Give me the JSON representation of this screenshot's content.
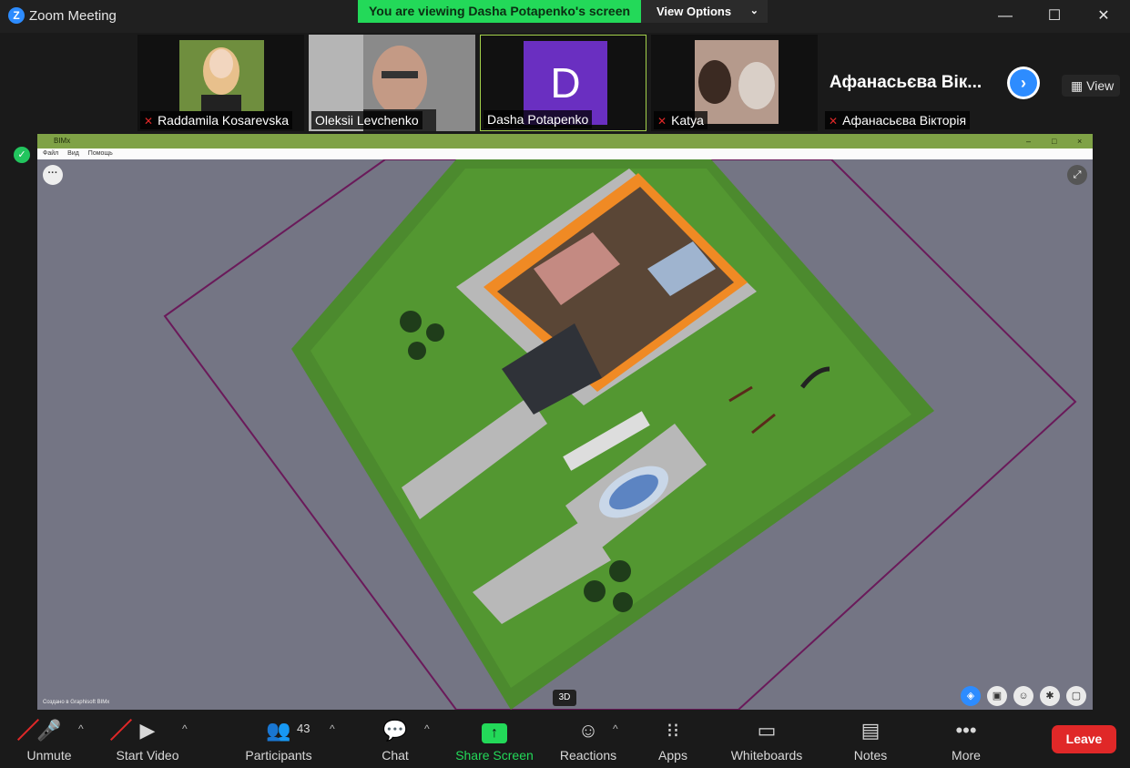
{
  "window": {
    "title": "Zoom Meeting",
    "logo": "Z",
    "controls": {
      "minimize": "—",
      "maximize": "☐",
      "close": "✕"
    }
  },
  "banner": {
    "text": "You are viewing Dasha Potapenko's screen",
    "view_options": "View Options",
    "chevron": "⌄"
  },
  "participants_strip": {
    "tiles": [
      {
        "name": "Raddamila Kosarevska",
        "muted": true
      },
      {
        "name": "Oleksii Levchenko",
        "muted": false
      },
      {
        "name": "Dasha Potapenko",
        "muted": false,
        "avatar_letter": "D",
        "avatar_color": "#6a2fc1",
        "active": true
      },
      {
        "name": "Katya",
        "muted": true
      },
      {
        "name": "Афанасьєва Вікторія",
        "display_name": "Афанасьєва Вік...",
        "muted": true
      }
    ],
    "next_icon": "›",
    "view_label": "View",
    "view_icon": "▦"
  },
  "security_icon": "✓",
  "shared_app": {
    "title": "BIMx",
    "menu": [
      "Файл",
      "Вид",
      "Помощь"
    ],
    "winbtns": [
      "–",
      "□",
      "×"
    ],
    "more_icon": "···",
    "expand_icon": "⤢",
    "credit": "Создано в Graphisoft BIMx",
    "mode": "3D",
    "tool_icons": [
      "◈",
      "▣",
      "☺",
      "✱",
      "▢"
    ]
  },
  "toolbar": {
    "unmute": "Unmute",
    "start_video": "Start Video",
    "participants": "Participants",
    "participants_count": "43",
    "chat": "Chat",
    "share_screen": "Share Screen",
    "reactions": "Reactions",
    "apps": "Apps",
    "whiteboards": "Whiteboards",
    "notes": "Notes",
    "more": "More",
    "leave": "Leave",
    "caret": "^",
    "icons": {
      "mic": "🎤",
      "video": "▶",
      "people": "👥",
      "chat": "💬",
      "share": "↑",
      "reactions": "☺",
      "apps": "⁝⁝",
      "whiteboard": "▭",
      "notes": "▤",
      "more": "•••"
    }
  },
  "colors": {
    "banner_green": "#23d959",
    "leave_red": "#e02828",
    "accent_blue": "#2d8cff",
    "active_border": "#a3d14a"
  }
}
